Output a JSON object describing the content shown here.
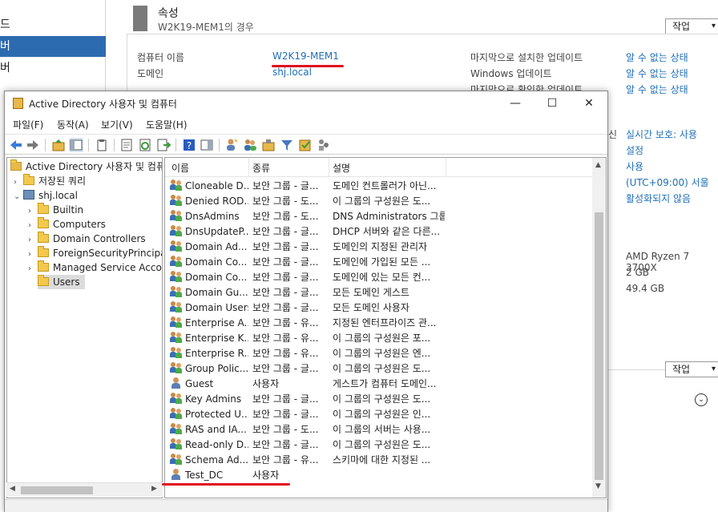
{
  "server_manager": {
    "nav_items": [
      "드",
      "버",
      "버"
    ],
    "properties_title": "속성",
    "properties_subtitle": "W2K19-MEM1의 경우",
    "tasks_label": "작업",
    "fields": {
      "computer_name_label": "컴퓨터 이름",
      "computer_name_value": "W2K19-MEM1",
      "domain_label": "도메인",
      "domain_value": "shj.local",
      "last_installed_label": "마지막으로 설치한 업데이트",
      "last_installed_value": "알 수 없는 상태",
      "windows_update_label": "Windows 업데이트",
      "windows_update_value": "알 수 없는 상태",
      "last_checked_label": "마지막으로 확인한 업데이트",
      "last_checked_value": "알 수 없는 상태"
    },
    "right_values": [
      "실시간 보호: 사용",
      "설정",
      "사용",
      "(UTC+09:00) 서울",
      "활성화되지 않음"
    ],
    "hardware": [
      "AMD Ryzen 7 3700X",
      "2 GB",
      "49.4 GB"
    ],
    "left_partial_label": "신"
  },
  "aduc": {
    "title": "Active Directory 사용자 및 컴퓨터",
    "window_buttons": {
      "minimize": "—",
      "maximize": "☐",
      "close": "✕"
    },
    "menu": [
      "파일(F)",
      "동작(A)",
      "보기(V)",
      "도움말(H)"
    ],
    "tree": {
      "root": "Active Directory 사용자 및 컴퓨터",
      "saved_queries": "저장된 쿼리",
      "domain": "shj.local",
      "children": [
        "Builtin",
        "Computers",
        "Domain Controllers",
        "ForeignSecurityPrincipals",
        "Managed Service Accounts",
        "Users"
      ]
    },
    "columns": [
      "이름",
      "종류",
      "설명"
    ],
    "rows": [
      {
        "icon": "group",
        "name": "Cloneable D...",
        "type": "보안 그룹 - 글...",
        "desc": "도메인 컨트롤러가 아닌..."
      },
      {
        "icon": "group",
        "name": "Denied ROD...",
        "type": "보안 그룹 - 도...",
        "desc": "이 그룹의 구성원은 도..."
      },
      {
        "icon": "group",
        "name": "DnsAdmins",
        "type": "보안 그룹 - 도...",
        "desc": "DNS Administrators 그룹"
      },
      {
        "icon": "group",
        "name": "DnsUpdateP...",
        "type": "보안 그룹 - 글...",
        "desc": "DHCP 서버와 같은 다른..."
      },
      {
        "icon": "group",
        "name": "Domain Ad...",
        "type": "보안 그룹 - 글...",
        "desc": "도메인의 지정된 관리자"
      },
      {
        "icon": "group",
        "name": "Domain Co...",
        "type": "보안 그룹 - 글...",
        "desc": "도메인에 가입된 모든 ..."
      },
      {
        "icon": "group",
        "name": "Domain Co...",
        "type": "보안 그룹 - 글...",
        "desc": "도메인에 있는 모든 컨..."
      },
      {
        "icon": "group",
        "name": "Domain Gu...",
        "type": "보안 그룹 - 글...",
        "desc": "모든 도메인 게스트"
      },
      {
        "icon": "group",
        "name": "Domain Users",
        "type": "보안 그룹 - 글...",
        "desc": "모든 도메인 사용자"
      },
      {
        "icon": "group",
        "name": "Enterprise A...",
        "type": "보안 그룹 - 유...",
        "desc": "지정된 엔터프라이즈 관..."
      },
      {
        "icon": "group",
        "name": "Enterprise K...",
        "type": "보안 그룹 - 유...",
        "desc": "이 그룹의 구성원은 포..."
      },
      {
        "icon": "group",
        "name": "Enterprise R...",
        "type": "보안 그룹 - 유...",
        "desc": "이 그룹의 구성원은 엔..."
      },
      {
        "icon": "group",
        "name": "Group Polic...",
        "type": "보안 그룹 - 글...",
        "desc": "이 그룹의 구성원은 도..."
      },
      {
        "icon": "user",
        "name": "Guest",
        "type": "사용자",
        "desc": "게스트가 컴퓨터 도메인..."
      },
      {
        "icon": "group",
        "name": "Key Admins",
        "type": "보안 그룹 - 글...",
        "desc": "이 그룹의 구성원은 도..."
      },
      {
        "icon": "group",
        "name": "Protected U...",
        "type": "보안 그룹 - 글...",
        "desc": "이 그룹의 구성원은 인..."
      },
      {
        "icon": "group",
        "name": "RAS and IA...",
        "type": "보안 그룹 - 도...",
        "desc": "이 그룹의 서버는 사용..."
      },
      {
        "icon": "group",
        "name": "Read-only D...",
        "type": "보안 그룹 - 글...",
        "desc": "이 그룹의 구성원은 도..."
      },
      {
        "icon": "group",
        "name": "Schema Ad...",
        "type": "보안 그룹 - 유...",
        "desc": "스키마에 대한 지정된 ..."
      },
      {
        "icon": "user",
        "name": "Test_DC",
        "type": "사용자",
        "desc": ""
      }
    ]
  },
  "colors": {
    "accent": "#2d6bb0",
    "link": "#1e6fb8",
    "annotation": "#e0101e"
  }
}
